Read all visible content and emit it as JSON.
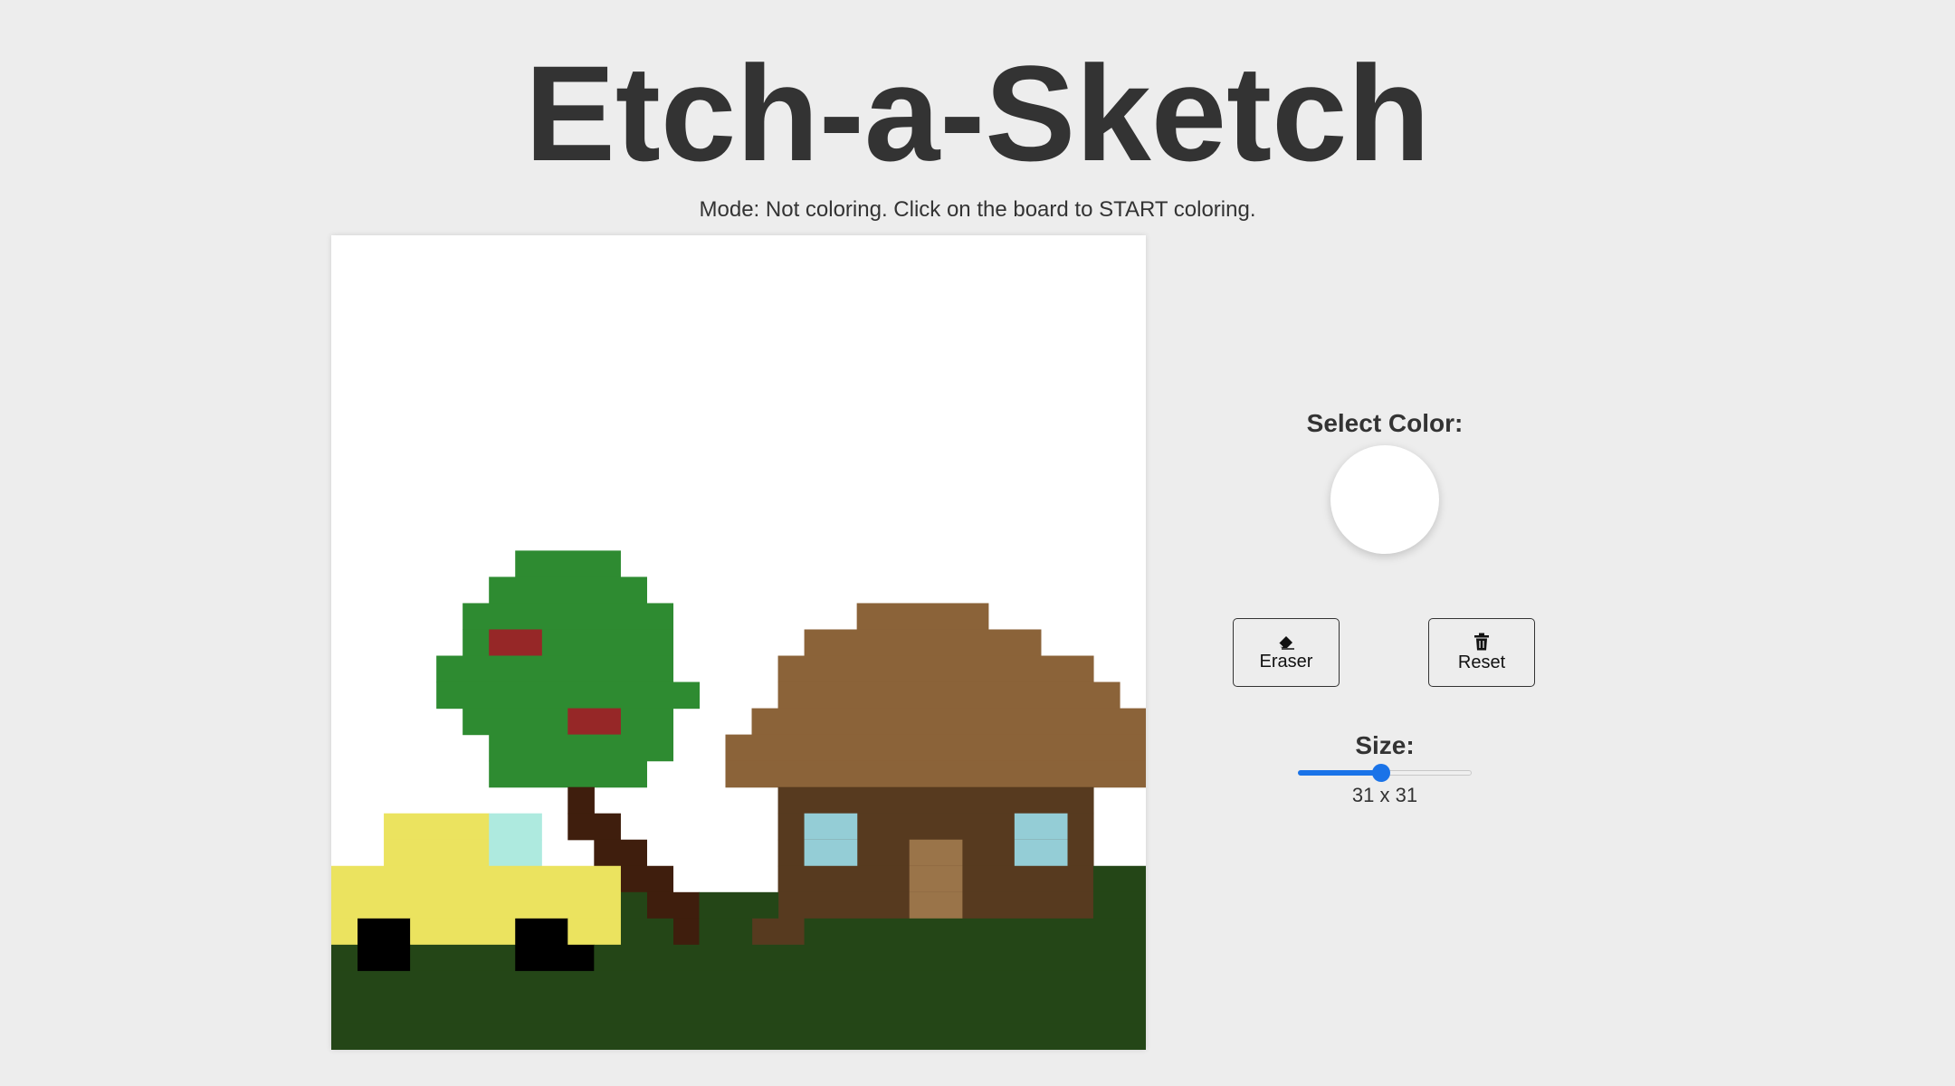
{
  "title": "Etch-a-Sketch",
  "mode_text": "Mode: Not coloring. Click on the board to START coloring.",
  "controls": {
    "select_color_label": "Select Color:",
    "selected_color": "#ffffff",
    "eraser_label": "Eraser",
    "eraser_icon": "eraser-icon",
    "reset_label": "Reset",
    "reset_icon": "trash-icon",
    "size_label": "Size:",
    "size_value_text": "31 x 31",
    "size_slider_fraction": 0.48
  },
  "board": {
    "grid_size": 31,
    "colors": {
      "green_tree": "#2e8b31",
      "red_apple": "#962727",
      "trunk": "#3f1e0d",
      "roof": "#8b6339",
      "wall": "#573a1f",
      "window": "#94cdd6",
      "door": "#9a7449",
      "grass": "#244617",
      "car_body": "#ebe35f",
      "car_window": "#aeeadf",
      "wheel": "#000000"
    },
    "pixels": [
      {
        "row": 12,
        "c0": 7,
        "c1": 10,
        "color": "green_tree"
      },
      {
        "row": 13,
        "c0": 6,
        "c1": 11,
        "color": "green_tree"
      },
      {
        "row": 14,
        "c0": 5,
        "c1": 12,
        "color": "green_tree"
      },
      {
        "row": 15,
        "c0": 5,
        "c1": 12,
        "color": "green_tree"
      },
      {
        "row": 15,
        "c0": 6,
        "c1": 7,
        "color": "red_apple"
      },
      {
        "row": 16,
        "c0": 4,
        "c1": 12,
        "color": "green_tree"
      },
      {
        "row": 17,
        "c0": 4,
        "c1": 13,
        "color": "green_tree"
      },
      {
        "row": 18,
        "c0": 5,
        "c1": 12,
        "color": "green_tree"
      },
      {
        "row": 18,
        "c0": 9,
        "c1": 10,
        "color": "red_apple"
      },
      {
        "row": 19,
        "c0": 6,
        "c1": 12,
        "color": "green_tree"
      },
      {
        "row": 20,
        "c0": 6,
        "c1": 11,
        "color": "green_tree"
      },
      {
        "row": 21,
        "c0": 9,
        "c1": 9,
        "color": "trunk"
      },
      {
        "row": 22,
        "c0": 9,
        "c1": 10,
        "color": "trunk"
      },
      {
        "row": 23,
        "c0": 10,
        "c1": 11,
        "color": "trunk"
      },
      {
        "row": 24,
        "c0": 11,
        "c1": 12,
        "color": "trunk"
      },
      {
        "row": 25,
        "c0": 12,
        "c1": 13,
        "color": "trunk"
      },
      {
        "row": 26,
        "c0": 13,
        "c1": 13,
        "color": "trunk"
      },
      {
        "row": 14,
        "c0": 20,
        "c1": 24,
        "color": "roof"
      },
      {
        "row": 15,
        "c0": 18,
        "c1": 26,
        "color": "roof"
      },
      {
        "row": 16,
        "c0": 17,
        "c1": 28,
        "color": "roof"
      },
      {
        "row": 17,
        "c0": 17,
        "c1": 29,
        "color": "roof"
      },
      {
        "row": 18,
        "c0": 16,
        "c1": 30,
        "color": "roof"
      },
      {
        "row": 19,
        "c0": 15,
        "c1": 30,
        "color": "roof"
      },
      {
        "row": 20,
        "c0": 15,
        "c1": 30,
        "color": "roof"
      },
      {
        "row": 21,
        "c0": 17,
        "c1": 28,
        "color": "wall"
      },
      {
        "row": 22,
        "c0": 17,
        "c1": 28,
        "color": "wall"
      },
      {
        "row": 22,
        "c0": 18,
        "c1": 19,
        "color": "window"
      },
      {
        "row": 22,
        "c0": 26,
        "c1": 27,
        "color": "window"
      },
      {
        "row": 23,
        "c0": 17,
        "c1": 28,
        "color": "wall"
      },
      {
        "row": 23,
        "c0": 18,
        "c1": 19,
        "color": "window"
      },
      {
        "row": 23,
        "c0": 22,
        "c1": 23,
        "color": "door"
      },
      {
        "row": 23,
        "c0": 26,
        "c1": 27,
        "color": "window"
      },
      {
        "row": 24,
        "c0": 17,
        "c1": 28,
        "color": "wall"
      },
      {
        "row": 24,
        "c0": 22,
        "c1": 23,
        "color": "door"
      },
      {
        "row": 24,
        "c0": 29,
        "c1": 30,
        "color": "grass"
      },
      {
        "row": 25,
        "c0": 17,
        "c1": 28,
        "color": "wall"
      },
      {
        "row": 25,
        "c0": 22,
        "c1": 23,
        "color": "door"
      },
      {
        "row": 25,
        "c0": 14,
        "c1": 16,
        "color": "grass"
      },
      {
        "row": 25,
        "c0": 29,
        "c1": 30,
        "color": "grass"
      },
      {
        "row": 26,
        "c0": 16,
        "c1": 17,
        "color": "wall"
      },
      {
        "row": 26,
        "c0": 14,
        "c1": 15,
        "color": "grass"
      },
      {
        "row": 26,
        "c0": 18,
        "c1": 30,
        "color": "grass"
      },
      {
        "row": 25,
        "c0": 11,
        "c1": 11,
        "color": "grass"
      },
      {
        "row": 26,
        "c0": 11,
        "c1": 12,
        "color": "grass"
      },
      {
        "row": 22,
        "c0": 2,
        "c1": 5,
        "color": "car_body"
      },
      {
        "row": 22,
        "c0": 6,
        "c1": 7,
        "color": "car_window"
      },
      {
        "row": 23,
        "c0": 2,
        "c1": 5,
        "color": "car_body"
      },
      {
        "row": 23,
        "c0": 6,
        "c1": 7,
        "color": "car_window"
      },
      {
        "row": 24,
        "c0": 0,
        "c1": 10,
        "color": "car_body"
      },
      {
        "row": 25,
        "c0": 0,
        "c1": 10,
        "color": "car_body"
      },
      {
        "row": 26,
        "c0": 0,
        "c1": 0,
        "color": "car_body"
      },
      {
        "row": 26,
        "c0": 1,
        "c1": 2,
        "color": "wheel"
      },
      {
        "row": 26,
        "c0": 3,
        "c1": 6,
        "color": "car_body"
      },
      {
        "row": 26,
        "c0": 7,
        "c1": 8,
        "color": "wheel"
      },
      {
        "row": 26,
        "c0": 9,
        "c1": 10,
        "color": "car_body"
      },
      {
        "row": 27,
        "c0": 0,
        "c1": 0,
        "color": "grass"
      },
      {
        "row": 27,
        "c0": 1,
        "c1": 2,
        "color": "wheel"
      },
      {
        "row": 27,
        "c0": 3,
        "c1": 6,
        "color": "grass"
      },
      {
        "row": 27,
        "c0": 7,
        "c1": 9,
        "color": "wheel"
      },
      {
        "row": 27,
        "c0": 10,
        "c1": 30,
        "color": "grass"
      },
      {
        "row": 28,
        "c0": 0,
        "c1": 30,
        "color": "grass"
      },
      {
        "row": 29,
        "c0": 0,
        "c1": 30,
        "color": "grass"
      },
      {
        "row": 30,
        "c0": 0,
        "c1": 30,
        "color": "grass"
      }
    ]
  }
}
